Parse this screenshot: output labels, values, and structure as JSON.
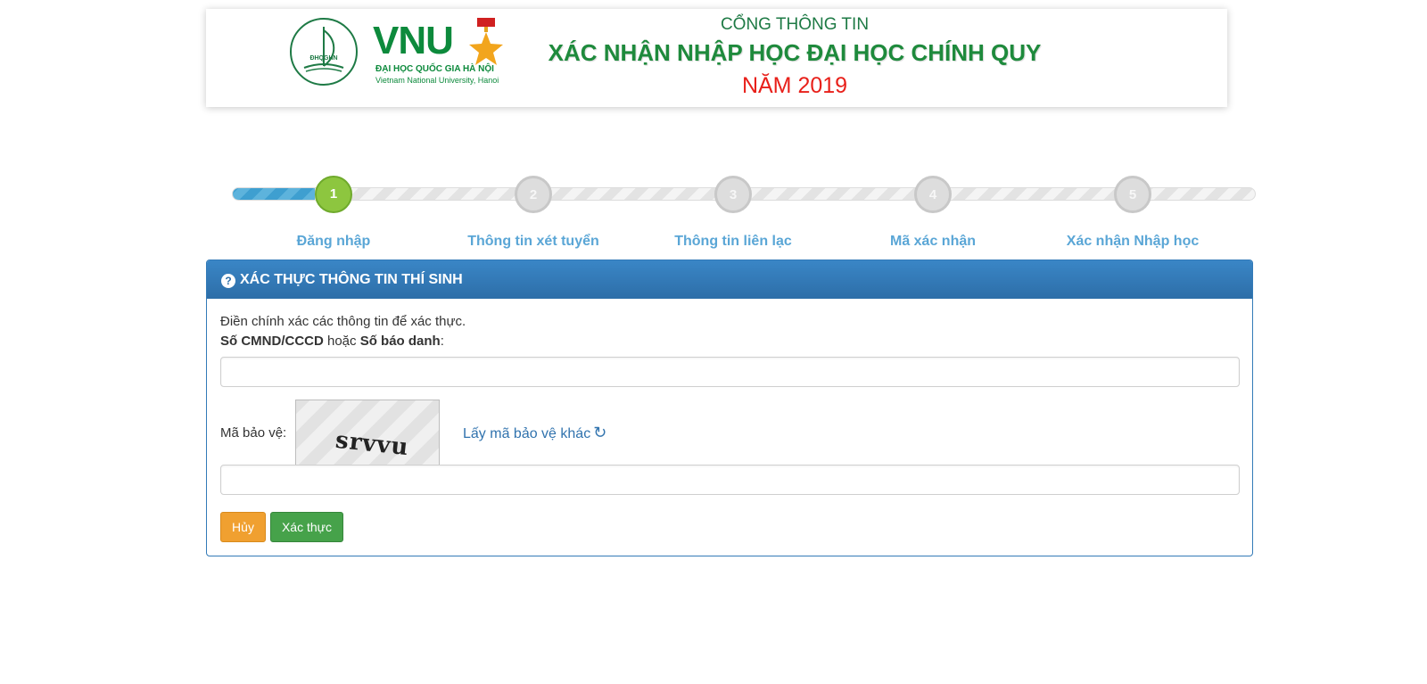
{
  "header": {
    "logo": {
      "circle_text": "ĐHQGHN",
      "brand": "VNU",
      "name_vi": "ĐẠI HỌC QUỐC GIA HÀ NỘI",
      "name_en": "Vietnam National University, Hanoi"
    },
    "line1": "CỔNG THÔNG TIN",
    "line2": "XÁC NHẬN NHẬP HỌC ĐẠI HỌC CHÍNH QUY",
    "line3": "NĂM 2019"
  },
  "progress": {
    "current_step": 1,
    "fill_fraction": 0.08,
    "steps": [
      {
        "number": "1",
        "label": "Đăng nhập"
      },
      {
        "number": "2",
        "label": "Thông tin xét tuyển"
      },
      {
        "number": "3",
        "label": "Thông tin liên lạc"
      },
      {
        "number": "4",
        "label": "Mã xác nhận"
      },
      {
        "number": "5",
        "label": "Xác nhận Nhập học"
      }
    ]
  },
  "panel": {
    "title": "XÁC THỰC THÔNG TIN THÍ SINH",
    "intro": "Điền chính xác các thông tin để xác thực.",
    "id_label_part1": "Số CMND/CCCD",
    "id_label_part2": " hoặc ",
    "id_label_part3": "Số báo danh",
    "id_label_part4": ":",
    "id_input_value": "",
    "captcha_label": "Mã bảo vệ:",
    "captcha_text": "srvvu",
    "captcha_refresh": "Lấy mã bảo vệ khác",
    "captcha_input_value": "",
    "cancel_button": "Hủy",
    "confirm_button": "Xác thực"
  },
  "colors": {
    "brand_green": "#0d8a3c",
    "title_red": "#e8201a",
    "panel_blue": "#337ab7",
    "step_active": "#8dc63f",
    "cancel_orange": "#f0a030",
    "confirm_green": "#46a24a"
  }
}
